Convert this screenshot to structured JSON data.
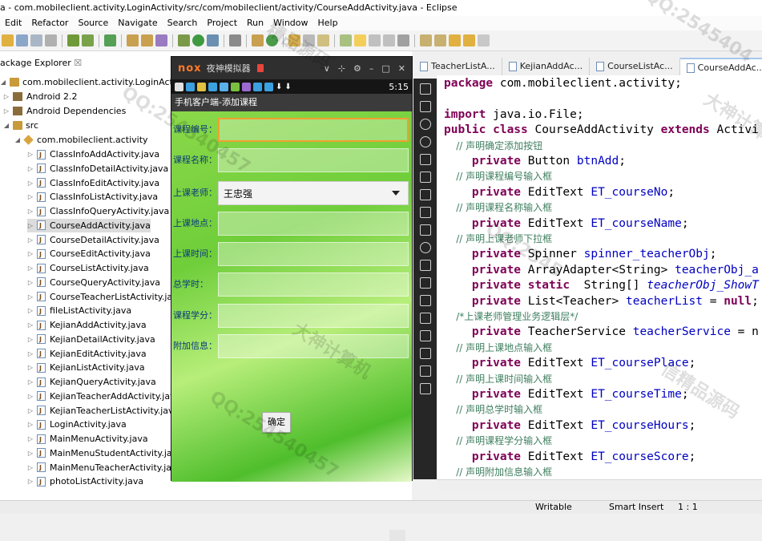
{
  "window": {
    "title": "a - com.mobileclient.activity.LoginActivity/src/com/mobileclient/activity/CourseAddActivity.java - Eclipse"
  },
  "menu": [
    "Edit",
    "Refactor",
    "Source",
    "Navigate",
    "Search",
    "Project",
    "Run",
    "Window",
    "Help"
  ],
  "package_explorer": {
    "tab_label": "ackage Explorer",
    "close": "☒",
    "project": "com.mobileclient.activity.LoginActivity",
    "android": "Android 2.2",
    "deps": "Android Dependencies",
    "src": "src",
    "package": "com.mobileclient.activity",
    "files": [
      "ClassInfoAddActivity.java",
      "ClassInfoDetailActivity.java",
      "ClassInfoEditActivity.java",
      "ClassInfoListActivity.java",
      "ClassInfoQueryActivity.java",
      "CourseAddActivity.java",
      "CourseDetailActivity.java",
      "CourseEditActivity.java",
      "CourseListActivity.java",
      "CourseQueryActivity.java",
      "CourseTeacherListActivity.java",
      "fileListActivity.java",
      "KejianAddActivity.java",
      "KejianDetailActivity.java",
      "KejianEditActivity.java",
      "KejianListActivity.java",
      "KejianQueryActivity.java",
      "KejianTeacherAddActivity.java",
      "KejianTeacherListActivity.java",
      "LoginActivity.java",
      "MainMenuActivity.java",
      "MainMenuStudentActivity.java",
      "MainMenuTeacherActivity.java",
      "photoListActivity.java"
    ]
  },
  "emulator": {
    "logo": "nox",
    "name": "夜神模拟器",
    "controls": [
      "∨",
      "⊹",
      "⚙",
      "–",
      "□",
      "✕"
    ],
    "time": "5:15",
    "app_title": "手机客户端-添加课程",
    "fields": [
      {
        "label": "课程编号：",
        "type": "input"
      },
      {
        "label": "课程名称：",
        "type": "input"
      },
      {
        "label": "上课老师：",
        "type": "select",
        "value": "王忠强"
      },
      {
        "label": "上课地点：",
        "type": "input"
      },
      {
        "label": "上课时间：",
        "type": "input"
      },
      {
        "label": "总学时：",
        "type": "input"
      },
      {
        "label": "课程学分：",
        "type": "input"
      },
      {
        "label": "附加信息：",
        "type": "input"
      }
    ],
    "ok_button": "确定"
  },
  "editor": {
    "tabs": [
      "TeacherListA...",
      "KejianAddAc...",
      "CourseListAc...",
      "CourseAddAc..."
    ],
    "lines": [
      {
        "kw": "package ",
        "t": "com.mobileclient.activity;"
      },
      {
        "kw": "",
        "t": ""
      },
      {
        "kw": "import ",
        "t": "java.io.File;"
      },
      {
        "kw": "public class ",
        "t": "CourseAddActivity ",
        "kw2": "extends ",
        "t2": "Activi"
      },
      {
        "cm": "    // 声明确定添加按钮"
      },
      {
        "kw": "    private ",
        "t": "Button ",
        "f": "btnAdd",
        "e": ";"
      },
      {
        "cm": "    // 声明课程编号输入框"
      },
      {
        "kw": "    private ",
        "t": "EditText ",
        "f": "ET_courseNo",
        "e": ";"
      },
      {
        "cm": "    // 声明课程名称输入框"
      },
      {
        "kw": "    private ",
        "t": "EditText ",
        "f": "ET_courseName",
        "e": ";"
      },
      {
        "cm": "    // 声明上课老师下拉框"
      },
      {
        "kw": "    private ",
        "t": "Spinner ",
        "f": "spinner_teacherObj",
        "e": ";"
      },
      {
        "kw": "    private ",
        "t": "ArrayAdapter<String> ",
        "f": "teacherObj_a",
        "e": ""
      },
      {
        "kw": "    private static ",
        "t": " String[] ",
        "sf": "teacherObj_ShowT",
        "e": ""
      },
      {
        "kw": "    private ",
        "t": "List<Teacher> ",
        "f": "teacherList",
        "e": " = ",
        "kw3": "null",
        "e2": ";"
      },
      {
        "cm": "    /*上课老师管理业务逻辑层*/"
      },
      {
        "kw": "    private ",
        "t": "TeacherService ",
        "f": "teacherService",
        "e": " = n"
      },
      {
        "cm": "    // 声明上课地点输入框"
      },
      {
        "kw": "    private ",
        "t": "EditText ",
        "f": "ET_coursePlace",
        "e": ";"
      },
      {
        "cm": "    // 声明上课时间输入框"
      },
      {
        "kw": "    private ",
        "t": "EditText ",
        "f": "ET_courseTime",
        "e": ";"
      },
      {
        "cm": "    // 声明总学时输入框"
      },
      {
        "kw": "    private ",
        "t": "EditText ",
        "f": "ET_courseHours",
        "e": ";"
      },
      {
        "cm": "    // 声明课程学分输入框"
      },
      {
        "kw": "    private ",
        "t": "EditText ",
        "f": "ET_courseScore",
        "e": ";"
      },
      {
        "cm": "    // 声明附加信息输入框"
      }
    ]
  },
  "status": {
    "writable": "Writable",
    "insert": "Smart Insert",
    "pos": "1 : 1"
  },
  "watermarks": [
    "QQ:2545404",
    "大神计算机设计",
    "QQ:254540457",
    "精品源码",
    "QQ:2545",
    "大神计算机",
    "QQ:254540457",
    "信精品源码"
  ]
}
